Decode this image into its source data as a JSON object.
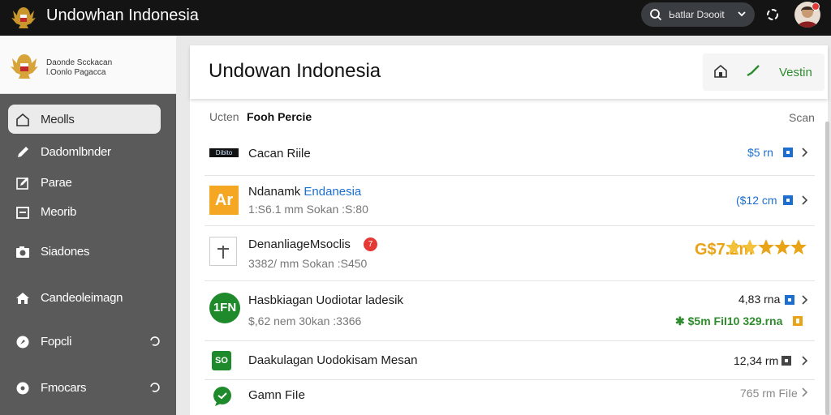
{
  "app": {
    "title": "Undowhan  Indonesia"
  },
  "search": {
    "text": "Ьatlar Dэooit"
  },
  "sidebar": {
    "header_line1": "Daonde Scckacan",
    "header_line2": "l.Oonlo Pagacca",
    "items": [
      {
        "label": "Meolls",
        "icon": "home-icon",
        "active": true
      },
      {
        "label": "Dadomlbnder",
        "icon": "edit-icon"
      },
      {
        "label": "Parae",
        "icon": "pen-icon"
      },
      {
        "label": "Meorib",
        "icon": "window-icon"
      },
      {
        "label": "Siadones",
        "icon": "camera-icon"
      },
      {
        "label": "Candeoleimagn",
        "icon": "house-icon"
      },
      {
        "label": "Fopcli",
        "icon": "settings-icon"
      },
      {
        "label": "Fmocars",
        "icon": "info-icon"
      }
    ]
  },
  "main": {
    "title": "Undowan Indonesia",
    "action_label": "Vestin",
    "list_header_prefix": "Ucten",
    "list_header_bold": "Fooh Percie",
    "list_header_right": "Scan"
  },
  "rows": [
    {
      "thumb_text": "Dibito",
      "title": "Cacan Riile",
      "size": "$5 rn"
    },
    {
      "thumb_text": "Ar",
      "title_prefix": "Ndanamk",
      "title_blue": "Endanesia",
      "subtitle": "1:S6.1 mm  Sokan :S:80",
      "size": "($12 cm"
    },
    {
      "title": "DenanliageMsoclis",
      "badge": "7",
      "subtitle": "3382/ mm  Sokan :S450",
      "size": "G$7.2m",
      "rating": 5
    },
    {
      "thumb_text": "1FN",
      "title": "Hasbkiagan Uodiotar ladesik",
      "subtitle": "$,62 nem  30kan :3366",
      "size": "4,83 rna",
      "extra": "$5m FiI10  329.rna"
    },
    {
      "thumb_text": "SO",
      "title": "Daakulagan Uodokisam Mesan",
      "size": "12,34 rm"
    },
    {
      "title": "Gamn FiIe",
      "size": "765 rm FiIe"
    }
  ],
  "colors": {
    "accent_green": "#2e8b2e",
    "accent_blue": "#1c6fd1",
    "gold": "#e8a317",
    "badge_red": "#e53935"
  }
}
